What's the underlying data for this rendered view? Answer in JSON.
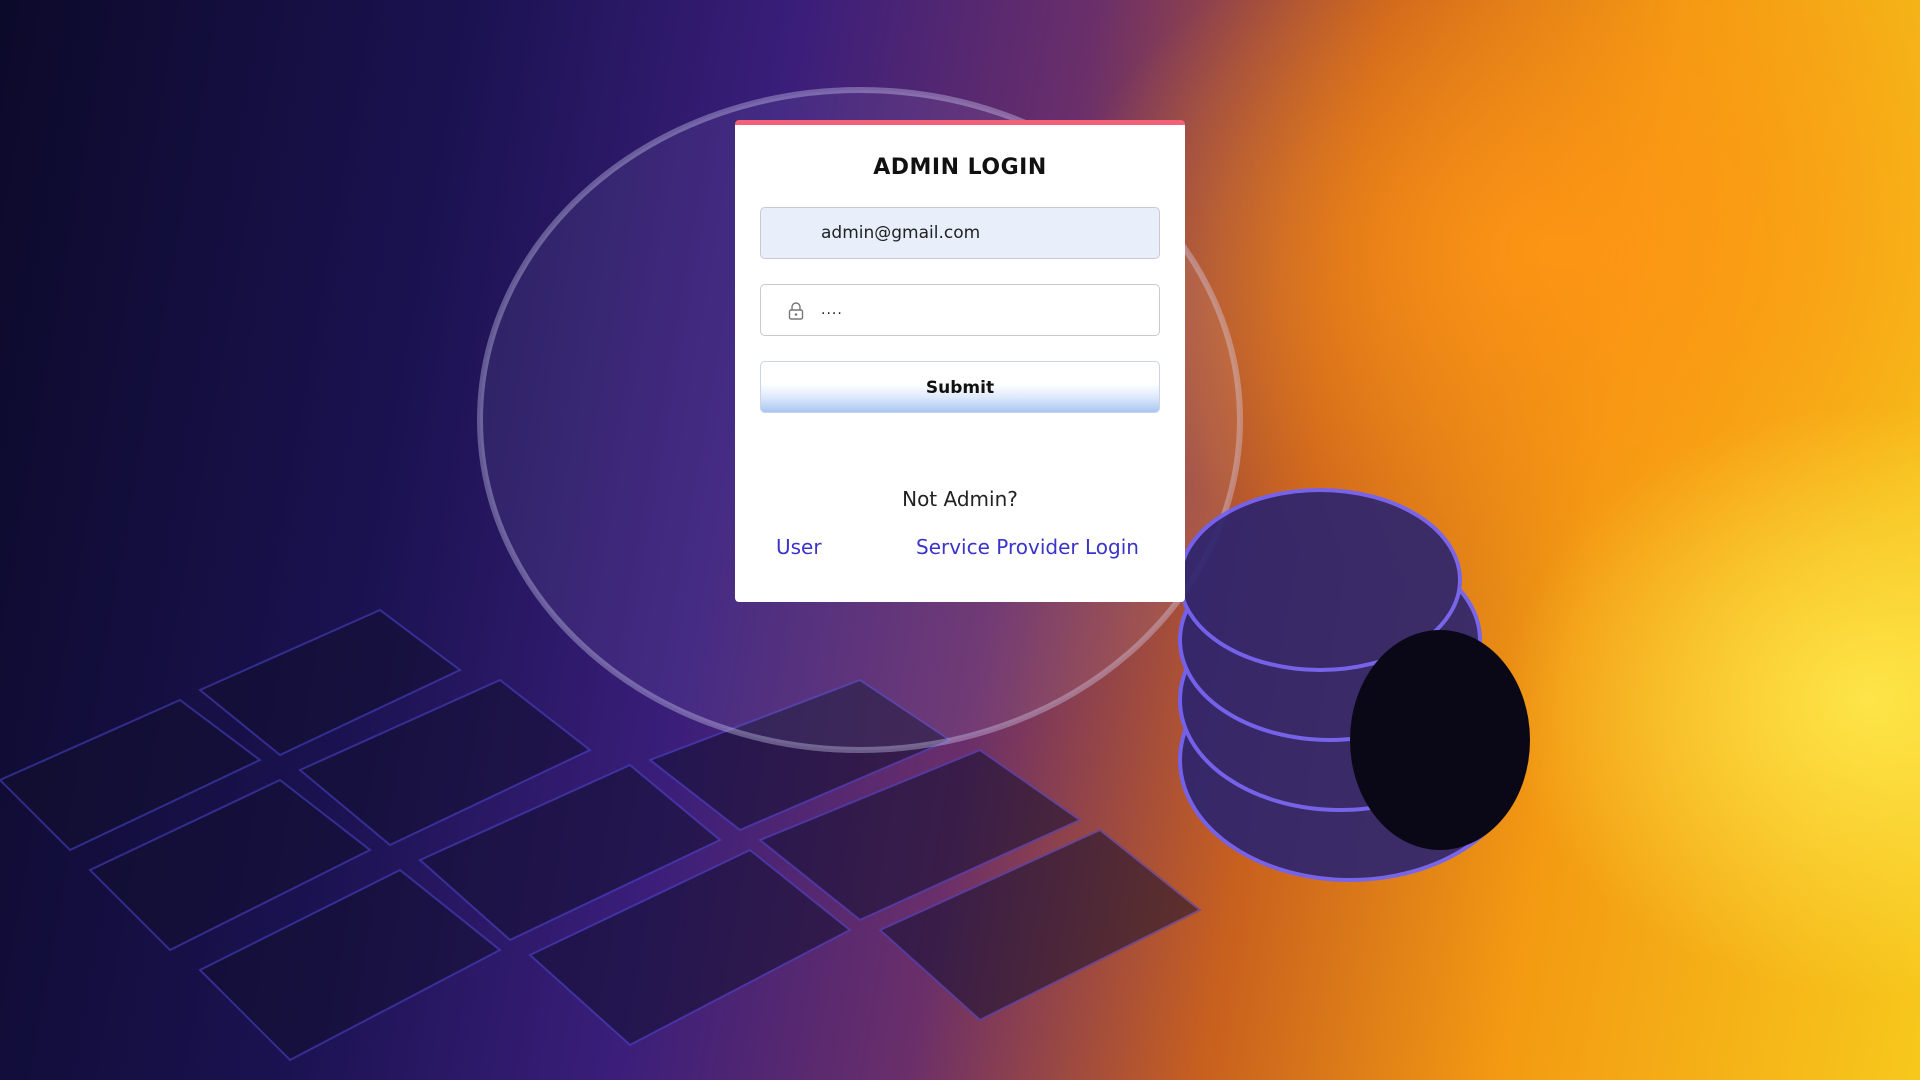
{
  "login": {
    "title": "ADMIN LOGIN",
    "email_value": "admin@gmail.com",
    "password_value": "....",
    "submit_label": "Submit",
    "not_admin_text": "Not Admin?",
    "user_link": "User",
    "service_provider_link": "Service Provider Login"
  },
  "colors": {
    "card_top_border": "#f2607a",
    "link": "#3a34c8",
    "email_field_bg": "#e8effb"
  },
  "icons": {
    "password_field": "lock-icon"
  }
}
